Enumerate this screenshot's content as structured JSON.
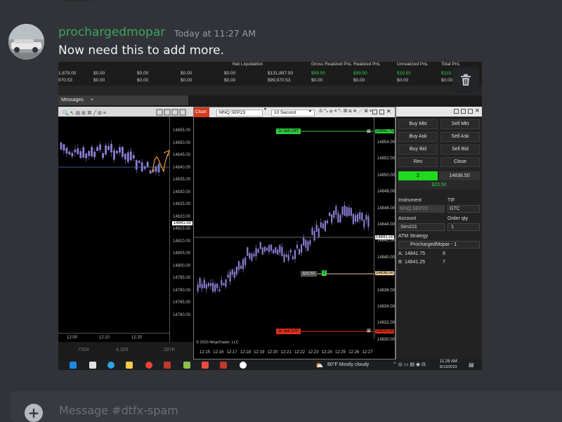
{
  "message": {
    "username": "prochargedmopar",
    "timestamp": "Today at 11:27 AM",
    "text": "Now need this to add more.",
    "username_color": "#3ba55c"
  },
  "attachment": {
    "account_bar": {
      "headers": [
        "Net Liquidation",
        "Gross Realized PnL",
        "Realized PnL",
        "Unrealized PnL",
        "Total PnL"
      ],
      "row1": [
        "1,879.00",
        "$0.00",
        "$0.00",
        "$0.00",
        "$0.00",
        "$131,897.50",
        "$99.50",
        "$99.50",
        "$18.50",
        "$118."
      ],
      "row2": [
        "970.53",
        "$0.00",
        "$0.00",
        "$0.00",
        "$0.00",
        "$99,970.53",
        "$0.00",
        "$0.00",
        "$0.00",
        "$0.00"
      ]
    },
    "messages_tab": "Messages",
    "left_chart": {
      "y_ticks": [
        "14855.00",
        "14850.00",
        "14845.00",
        "14840.00",
        "14835.00",
        "14830.00",
        "14825.00",
        "14820.00",
        "14815.00",
        "14810.00",
        "14805.00",
        "14800.00",
        "14795.00",
        "14790.00",
        "14785.00",
        "14780.00"
      ],
      "current_price": "14841.50",
      "x_ticks": [
        "12:00",
        "12:10",
        "12:20"
      ]
    },
    "main_chart": {
      "chart_tab": "Chart",
      "instrument": "MNQ SEP23",
      "interval": "10 Second",
      "y_ticks": [
        "14854.00",
        "14852.00",
        "14850.00",
        "14848.00",
        "14846.00",
        "14844.00",
        "14842.00",
        "14840.00",
        "14838.00",
        "14836.00",
        "14834.00",
        "14832.00",
        "14830.00"
      ],
      "x_ticks": [
        "12:15",
        "12:16",
        "12:17",
        "12:18",
        "12:19",
        "12:20",
        "12:21",
        "12:22",
        "12:23",
        "12:24",
        "12:25",
        "12:26",
        "12:27"
      ],
      "copyright": "© 2023 NinjaTrader, LLC",
      "sell_limit": {
        "label": "2x Sell LMT",
        "price": "14855.75"
      },
      "current": {
        "price": "14841.50"
      },
      "entry": {
        "label": "$20.50",
        "qty": "2",
        "price": "14836.50"
      },
      "sell_stop": {
        "label": "2x Sell STP",
        "price": "14828.50"
      }
    },
    "order_panel": {
      "buttons": [
        [
          "Buy Mkt",
          "Sell Mkt"
        ],
        [
          "Buy Ask",
          "Sell Ask"
        ],
        [
          "Buy Bid",
          "Sell Bid"
        ],
        [
          "Rev",
          "Close"
        ]
      ],
      "position_qty": "2",
      "position_price": "14836.50",
      "pnl": "$20.50",
      "instrument_label": "Instrument",
      "instrument_value": "MNQ SEP23",
      "tif_label": "TIF",
      "tif_value": "GTC",
      "account_label": "Account",
      "account_value": "Sim101",
      "qty_label": "Order qty",
      "qty_value": "1",
      "atm_label": "ATM Strategy",
      "atm_value": "ProchargedMopar - 1",
      "ask_label": "A:",
      "ask_price": "14841.75",
      "ask_size": "9",
      "bid_label": "B:",
      "bid_price": "14841.25",
      "bid_size": "7"
    },
    "left_bottom_stats": [
      "7204",
      "4,326",
      "287K"
    ],
    "taskbar": {
      "weather": "80°F  Mostly cloudy",
      "time": "11:26 AM",
      "date": "8/13/2023"
    }
  },
  "composer": {
    "placeholder": "Message #dtfx-spam"
  }
}
